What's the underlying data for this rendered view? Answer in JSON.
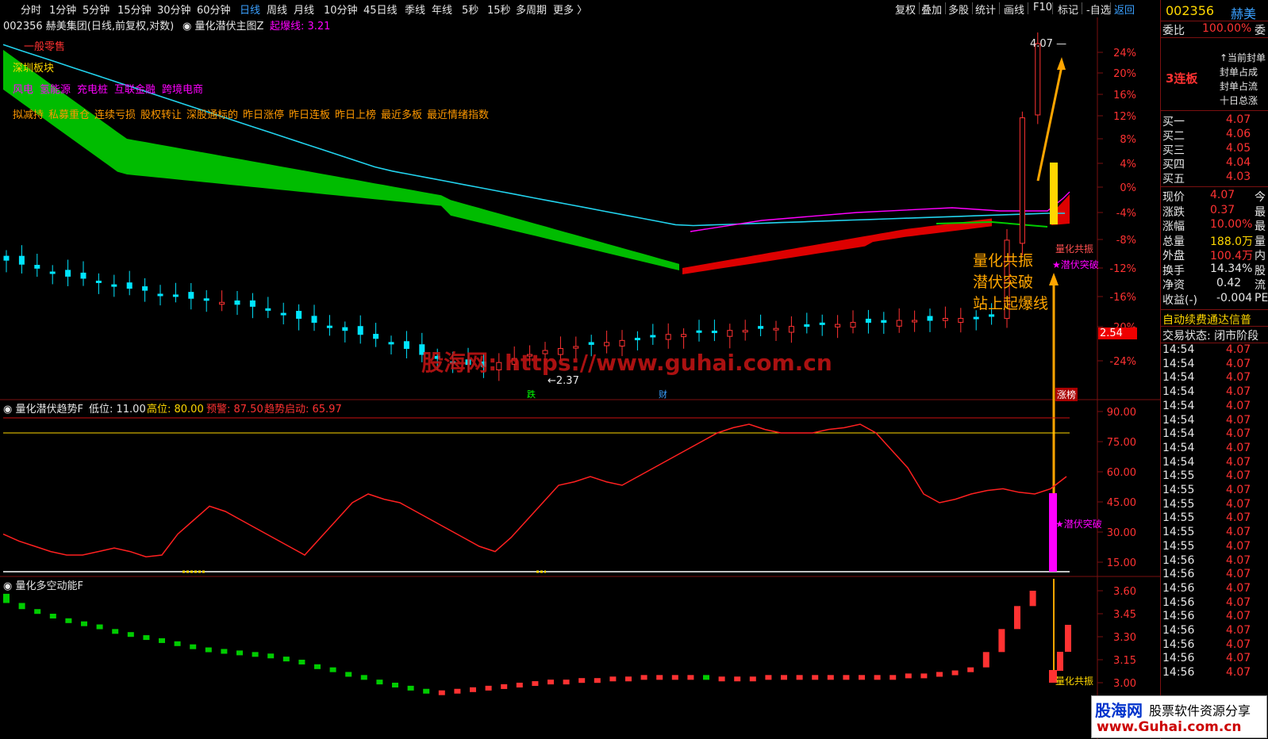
{
  "toolbar": {
    "periods": [
      "分时",
      "1分钟",
      "5分钟",
      "15分钟",
      "30分钟",
      "60分钟",
      "日线",
      "周线",
      "月线",
      "10分钟",
      "45日线",
      "季线",
      "年线",
      "5秒",
      "15秒",
      "多周期",
      "更多 〉"
    ],
    "active": "日线",
    "right": [
      "复权",
      "叠加",
      "多股",
      "统计",
      "画线",
      "F10",
      "标记",
      "-自选",
      "返回"
    ]
  },
  "main_title": {
    "stock": "002356 赫美集团(日线,前复权,对数)",
    "indicator": "量化潜伏主图Z",
    "param_label": "起爆线: 3.21"
  },
  "tags": {
    "line1": "一般零售",
    "line2": "深圳板块",
    "line3": [
      "风电",
      "氢能源",
      "充电桩",
      "互联金融",
      "跨境电商"
    ],
    "line4": [
      "拟减持",
      "私募重仓",
      "连续亏损",
      "股权转让",
      "深股通标的",
      "昨日涨停",
      "昨日连板",
      "昨日上榜",
      "最近多板",
      "最近情绪指数"
    ]
  },
  "annotations": {
    "high": "4.07",
    "low": "2.37",
    "big_text": [
      "量化共振",
      "潜伏突破",
      "站上起爆线"
    ],
    "resonance": "量化共振",
    "breakout": "★潜伏突破",
    "marker_die": "跌",
    "marker_cai": "财",
    "marker_zt": "涨榜",
    "current_price_tag": "2.54",
    "watermark_center": "股海网: https://www.guhai.com.cn"
  },
  "axis_main": [
    "24%",
    "20%",
    "16%",
    "12%",
    "8%",
    "4%",
    "0%",
    "-4%",
    "-8%",
    "-12%",
    "-16%",
    "-20%",
    "-24%"
  ],
  "panel2": {
    "title": "量化潜伏趋势F",
    "low_label": "低位: 11.00",
    "high_label": "高位: 80.00",
    "warn_label": "预警: 87.50",
    "trend_label": "趋势启动: 65.97",
    "axis": [
      "90.00",
      "75.00",
      "60.00",
      "45.00",
      "30.00",
      "15.00"
    ],
    "breakout": "★潜伏突破"
  },
  "panel3": {
    "title": "量化多空动能F",
    "axis": [
      "3.60",
      "3.45",
      "3.30",
      "3.15",
      "3.00"
    ],
    "resonance": "量化共振"
  },
  "right_panel": {
    "code": "002356",
    "name": "赫美",
    "weibi_label": "委比",
    "weibi_value": "100.00%",
    "weibi_suffix": "委",
    "board": "3连板",
    "feng_lines": [
      "↑当前封单",
      "封单占成",
      "封单占流",
      "十日总涨"
    ],
    "bids": [
      {
        "label": "买一",
        "price": "4.07"
      },
      {
        "label": "买二",
        "price": "4.06"
      },
      {
        "label": "买三",
        "price": "4.05"
      },
      {
        "label": "买四",
        "price": "4.04"
      },
      {
        "label": "买五",
        "price": "4.03"
      }
    ],
    "stats": [
      {
        "label": "现价",
        "value": "4.07",
        "suffix": "今",
        "color": "#ff3232"
      },
      {
        "label": "涨跌",
        "value": "0.37",
        "suffix": "最",
        "color": "#ff3232"
      },
      {
        "label": "涨幅",
        "value": "10.00%",
        "suffix": "最",
        "color": "#ff3232"
      },
      {
        "label": "总量",
        "value": "188.0万",
        "suffix": "量",
        "color": "#ffd700"
      },
      {
        "label": "外盘",
        "value": "100.4万",
        "suffix": "内",
        "color": "#ff3232"
      },
      {
        "label": "换手",
        "value": "14.34%",
        "suffix": "股",
        "color": "#e6e6e6"
      },
      {
        "label": "净资",
        "value": "0.42",
        "suffix": "流",
        "color": "#e6e6e6"
      },
      {
        "label": "收益(-)",
        "value": "-0.004",
        "suffix": "PE",
        "color": "#e6e6e6"
      }
    ],
    "auto_renew": "自动续费通达信普",
    "trade_state": "交易状态: 闭市阶段",
    "ticks": [
      {
        "t": "14:54",
        "p": "4.07"
      },
      {
        "t": "14:54",
        "p": "4.07"
      },
      {
        "t": "14:54",
        "p": "4.07"
      },
      {
        "t": "14:54",
        "p": "4.07"
      },
      {
        "t": "14:54",
        "p": "4.07"
      },
      {
        "t": "14:54",
        "p": "4.07"
      },
      {
        "t": "14:54",
        "p": "4.07"
      },
      {
        "t": "14:54",
        "p": "4.07"
      },
      {
        "t": "14:54",
        "p": "4.07"
      },
      {
        "t": "14:55",
        "p": "4.07"
      },
      {
        "t": "14:55",
        "p": "4.07"
      },
      {
        "t": "14:55",
        "p": "4.07"
      },
      {
        "t": "14:55",
        "p": "4.07"
      },
      {
        "t": "14:55",
        "p": "4.07"
      },
      {
        "t": "14:55",
        "p": "4.07"
      },
      {
        "t": "14:56",
        "p": "4.07"
      },
      {
        "t": "14:56",
        "p": "4.07"
      },
      {
        "t": "14:56",
        "p": "4.07"
      },
      {
        "t": "14:56",
        "p": "4.07"
      },
      {
        "t": "14:56",
        "p": "4.07"
      },
      {
        "t": "14:56",
        "p": "4.07"
      },
      {
        "t": "14:56",
        "p": "4.07"
      },
      {
        "t": "14:56",
        "p": "4.07"
      },
      {
        "t": "14:56",
        "p": "4.07"
      }
    ]
  },
  "watermark_logo": {
    "brand": "股海网",
    "slogan": "股票软件资源分享",
    "url": "www.Guhai.com.cn"
  },
  "colors": {
    "up": "#ff3232",
    "down": "#00e5ff",
    "ma": "#22d3ee",
    "band_green": "#00cc00",
    "band_red": "#dd0000",
    "yellow": "#ffd700",
    "magenta": "#ff00ff",
    "orange": "#ffa500"
  },
  "chart_data": {
    "type": "candlestick+indicators",
    "price_high": 4.07,
    "price_low": 2.37,
    "closes": [
      2.99,
      2.97,
      2.95,
      2.93,
      2.91,
      2.9,
      2.88,
      2.86,
      2.85,
      2.84,
      2.82,
      2.81,
      2.8,
      2.79,
      2.78,
      2.77,
      2.76,
      2.74,
      2.72,
      2.7,
      2.68,
      2.66,
      2.64,
      2.62,
      2.6,
      2.58,
      2.55,
      2.52,
      2.5,
      2.48,
      2.47,
      2.46,
      2.48,
      2.5,
      2.52,
      2.54,
      2.55,
      2.56,
      2.57,
      2.58,
      2.59,
      2.6,
      2.61,
      2.62,
      2.62,
      2.63,
      2.63,
      2.64,
      2.64,
      2.65,
      2.65,
      2.66,
      2.66,
      2.67,
      2.67,
      2.68,
      2.68,
      2.68,
      2.69,
      2.69,
      2.69,
      2.7,
      2.7,
      2.7,
      2.71,
      3.09,
      3.7,
      4.07
    ],
    "trend_line": [
      22,
      18,
      15,
      12,
      10,
      10,
      12,
      14,
      12,
      9,
      10,
      22,
      30,
      38,
      35,
      30,
      25,
      20,
      15,
      10,
      20,
      30,
      40,
      45,
      42,
      40,
      35,
      30,
      25,
      20,
      15,
      12,
      20,
      30,
      40,
      50,
      52,
      55,
      52,
      50,
      55,
      60,
      65,
      70,
      75,
      80,
      83,
      85,
      82,
      80,
      80,
      80,
      82,
      83,
      85,
      80,
      70,
      60,
      45,
      40,
      42,
      45,
      47,
      48,
      46,
      45,
      48,
      55
    ],
    "momentum": [
      3.58,
      3.52,
      3.48,
      3.45,
      3.42,
      3.4,
      3.38,
      3.35,
      3.33,
      3.31,
      3.29,
      3.27,
      3.25,
      3.23,
      3.22,
      3.21,
      3.2,
      3.19,
      3.17,
      3.15,
      3.12,
      3.1,
      3.07,
      3.05,
      3.02,
      3.0,
      2.98,
      2.96,
      2.95,
      2.95,
      2.96,
      2.97,
      2.98,
      2.99,
      3.0,
      3.01,
      3.02,
      3.02,
      3.03,
      3.03,
      3.04,
      3.04,
      3.05,
      3.05,
      3.05,
      3.05,
      3.04,
      3.04,
      3.04,
      3.04,
      3.05,
      3.05,
      3.05,
      3.05,
      3.05,
      3.05,
      3.05,
      3.05,
      3.05,
      3.06,
      3.06,
      3.07,
      3.08,
      3.1,
      3.2,
      3.35,
      3.5,
      3.6
    ]
  }
}
